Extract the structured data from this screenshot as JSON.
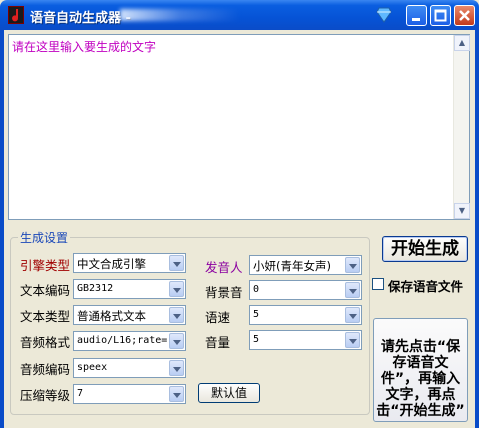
{
  "window": {
    "title": "语音自动生成器 -",
    "title_suffix_blurred": true
  },
  "text_input": {
    "placeholder_text": "请在这里输入要生成的文字"
  },
  "settings": {
    "group_title": "生成设置",
    "engine_type": {
      "label": "引擎类型",
      "value": "中文合成引擎"
    },
    "text_encoding": {
      "label": "文本编码",
      "value": "GB2312"
    },
    "text_type": {
      "label": "文本类型",
      "value": "普通格式文本"
    },
    "audio_format": {
      "label": "音频格式",
      "value": "audio/L16;rate="
    },
    "audio_encoding": {
      "label": "音频编码",
      "value": "speex"
    },
    "compression_level": {
      "label": "压缩等级",
      "value": "7"
    },
    "speaker": {
      "label": "发音人",
      "value": "小妍(青年女声)"
    },
    "background_sound": {
      "label": "背景音",
      "value": "0"
    },
    "speed": {
      "label": "语速",
      "value": "5"
    },
    "volume": {
      "label": "音量",
      "value": "5"
    },
    "default_button": "默认值"
  },
  "actions": {
    "start_button": "开始生成",
    "save_checkbox_label": "保存语音文件",
    "save_checked": false
  },
  "instructions": "请先点击“保存语音文件”，再输入文字，再点击“开始生成”",
  "colors": {
    "titlebar": "#0653d6",
    "window_bg": "#ece9d8",
    "accent_red": "#a00000",
    "accent_purple": "#8b00a0"
  }
}
